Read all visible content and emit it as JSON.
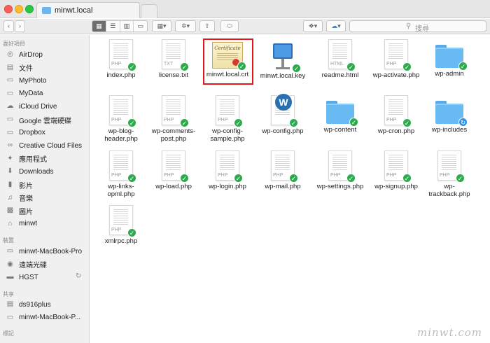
{
  "window": {
    "tab_title": "minwt.local",
    "search_placeholder": "搜尋"
  },
  "sidebar": {
    "favorites_header": "喜好項目",
    "favorites": [
      {
        "label": "AirDrop",
        "icon": "airdrop-icon"
      },
      {
        "label": "文件",
        "icon": "document-icon"
      },
      {
        "label": "MyPhoto",
        "icon": "folder-icon"
      },
      {
        "label": "MyData",
        "icon": "folder-icon"
      },
      {
        "label": "iCloud Drive",
        "icon": "cloud-icon"
      },
      {
        "label": "Google 雲端硬碟",
        "icon": "folder-icon"
      },
      {
        "label": "Dropbox",
        "icon": "folder-icon"
      },
      {
        "label": "Creative Cloud Files",
        "icon": "creative-cloud-icon"
      },
      {
        "label": "應用程式",
        "icon": "applications-icon"
      },
      {
        "label": "Downloads",
        "icon": "download-icon"
      },
      {
        "label": "影片",
        "icon": "movie-icon"
      },
      {
        "label": "音樂",
        "icon": "music-icon"
      },
      {
        "label": "圖片",
        "icon": "picture-icon"
      },
      {
        "label": "minwt",
        "icon": "home-icon"
      }
    ],
    "devices_header": "裝置",
    "devices": [
      {
        "label": "minwt-MacBook-Pro",
        "icon": "laptop-icon"
      },
      {
        "label": "遠端光碟",
        "icon": "disc-icon"
      },
      {
        "label": "HGST",
        "icon": "drive-icon"
      }
    ],
    "shared_header": "共享",
    "shared": [
      {
        "label": "ds916plus",
        "icon": "server-icon"
      },
      {
        "label": "minwt-MacBook-P...",
        "icon": "laptop-icon"
      }
    ],
    "tags_header": "標記"
  },
  "files": [
    {
      "label": "index.php",
      "type": "doc",
      "ext": "PHP"
    },
    {
      "label": "license.txt",
      "type": "doc",
      "ext": "TXT"
    },
    {
      "label": "minwt.local.crt",
      "type": "cert",
      "selected": true
    },
    {
      "label": "minwt.local.key",
      "type": "keynote"
    },
    {
      "label": "readme.html",
      "type": "doc",
      "ext": "HTML"
    },
    {
      "label": "wp-activate.php",
      "type": "doc",
      "ext": "PHP"
    },
    {
      "label": "wp-admin",
      "type": "folder"
    },
    {
      "label": "wp-blog-\nheader.php",
      "type": "doc",
      "ext": "PHP"
    },
    {
      "label": "wp-comments-\npost.php",
      "type": "doc",
      "ext": "PHP"
    },
    {
      "label": "wp-config-\nsample.php",
      "type": "doc",
      "ext": "PHP"
    },
    {
      "label": "wp-config.php",
      "type": "wpdoc"
    },
    {
      "label": "wp-content",
      "type": "folder"
    },
    {
      "label": "wp-cron.php",
      "type": "doc",
      "ext": "PHP"
    },
    {
      "label": "wp-includes",
      "type": "folder",
      "sync": true
    },
    {
      "label": "wp-links-\nopml.php",
      "type": "doc",
      "ext": "PHP"
    },
    {
      "label": "wp-load.php",
      "type": "doc",
      "ext": "PHP"
    },
    {
      "label": "wp-login.php",
      "type": "doc",
      "ext": "PHP"
    },
    {
      "label": "wp-mail.php",
      "type": "doc",
      "ext": "PHP"
    },
    {
      "label": "wp-settings.php",
      "type": "doc",
      "ext": "PHP"
    },
    {
      "label": "wp-signup.php",
      "type": "doc",
      "ext": "PHP"
    },
    {
      "label": "wp-\ntrackback.php",
      "type": "doc",
      "ext": "PHP"
    },
    {
      "label": "xmlrpc.php",
      "type": "doc",
      "ext": "PHP"
    }
  ],
  "cert_title": "Certificate",
  "watermark": "minwt.com"
}
